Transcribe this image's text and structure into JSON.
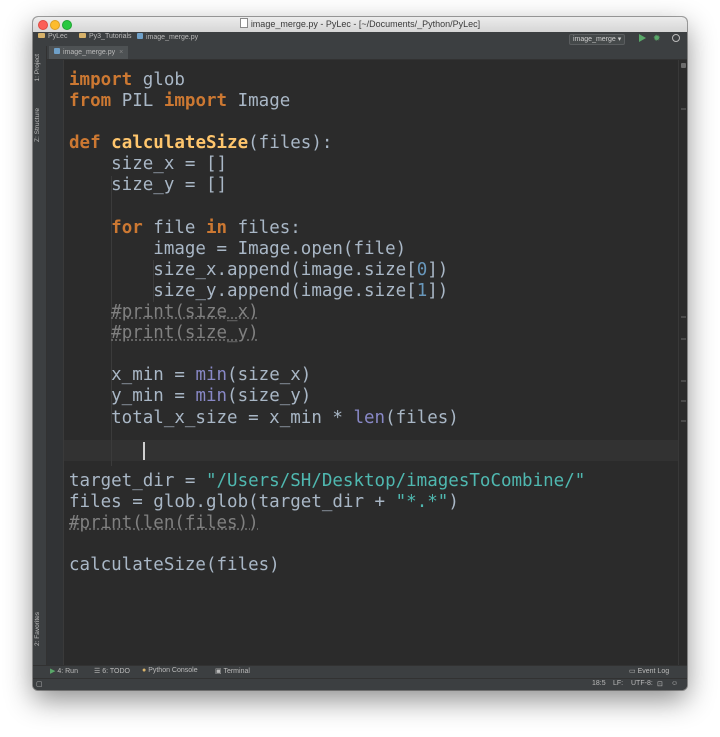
{
  "window": {
    "title": "image_merge.py - PyLec - [~/Documents/_Python/PyLec]"
  },
  "navbar": {
    "breadcrumbs": [
      "PyLec",
      "Py3_Tutorials",
      "image_merge.py"
    ],
    "run_config": "image_merge",
    "run_config_arrow": "▾"
  },
  "left_tools": {
    "project": "1: Project",
    "structure": "Z: Structure",
    "favorites": "2: Favorites"
  },
  "editor": {
    "tab_label": "image_merge.py",
    "tab_close": "×",
    "code_lines": [
      "import glob",
      "from PIL import Image",
      "",
      "def calculateSize(files):",
      "    size_x = []",
      "    size_y = []",
      "",
      "    for file in files:",
      "        image = Image.open(file)",
      "        size_x.append(image.size[0])",
      "        size_y.append(image.size[1])",
      "    #print(size_x)",
      "    #print(size_y)",
      "",
      "    x_min = min(size_x)",
      "    y_min = min(size_y)",
      "    total_x_size = x_min * len(files)",
      "    ",
      "",
      "target_dir = \"/Users/SH/Desktop/imagesToCombine/\"",
      "files = glob.glob(target_dir + \"*.*\")",
      "#print(len(files))",
      "",
      "calculateSize(files)"
    ],
    "current_line": 18
  },
  "bottom_tools": {
    "run": "4: Run",
    "todo": "6: TODO",
    "python_console": "Python Console",
    "terminal": "Terminal",
    "event_log": "Event Log"
  },
  "status": {
    "position": "18:5",
    "line_separator": "LF:",
    "encoding": "UTF-8:"
  },
  "colors": {
    "editor_bg": "#2b2b2b",
    "keyword": "#cc7832",
    "function": "#ffc66d",
    "builtin": "#8888c6",
    "number": "#6897bb",
    "string": "#4fb8b0",
    "comment": "#808080",
    "text": "#a9b7c6"
  }
}
